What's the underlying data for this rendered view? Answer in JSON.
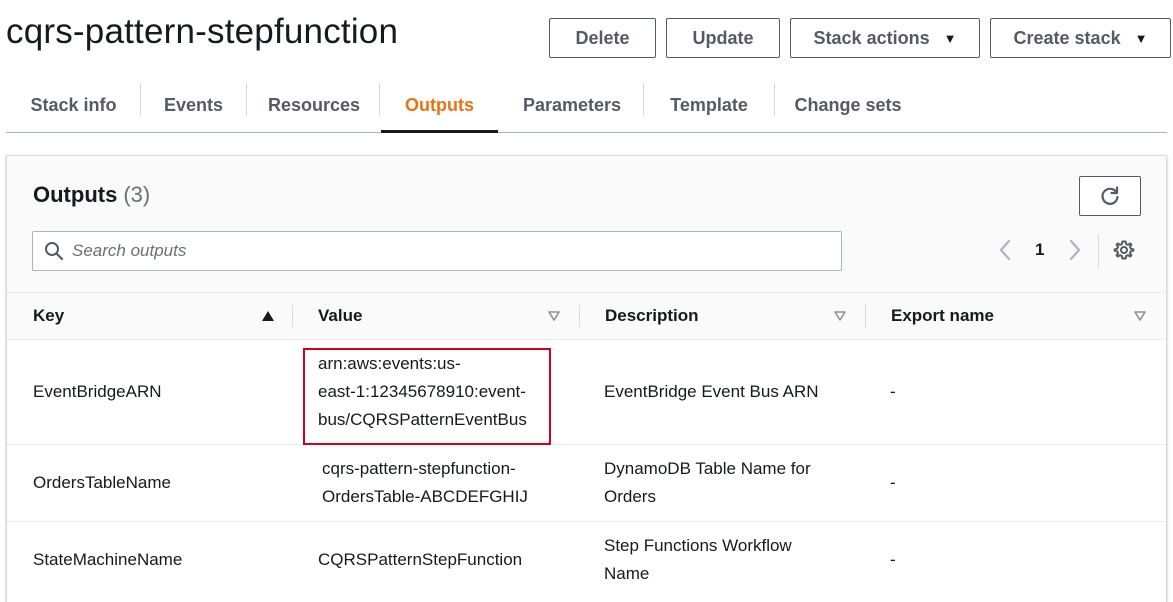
{
  "page": {
    "title": "cqrs-pattern-stepfunction"
  },
  "header_buttons": {
    "delete": "Delete",
    "update": "Update",
    "stack_actions": "Stack actions",
    "create_stack": "Create stack"
  },
  "tabs": [
    {
      "label": "Stack info"
    },
    {
      "label": "Events"
    },
    {
      "label": "Resources"
    },
    {
      "label": "Outputs",
      "active": true
    },
    {
      "label": "Parameters"
    },
    {
      "label": "Template"
    },
    {
      "label": "Change sets"
    }
  ],
  "outputs": {
    "title": "Outputs",
    "count": "(3)",
    "search_placeholder": "Search outputs",
    "page_number": "1",
    "columns": {
      "key": "Key",
      "value": "Value",
      "description": "Description",
      "export_name": "Export name"
    },
    "rows": [
      {
        "key": "EventBridgeARN",
        "value_lines": [
          "arn:aws:events:us-",
          "east-1:12345678910:event-",
          "bus/CQRSPatternEventBus"
        ],
        "description_lines": [
          "EventBridge Event Bus ARN"
        ],
        "export_name": "-"
      },
      {
        "key": "OrdersTableName",
        "value_lines": [
          "cqrs-pattern-stepfunction-",
          "OrdersTable-ABCDEFGHIJ"
        ],
        "description_lines": [
          "DynamoDB Table Name for",
          "Orders"
        ],
        "export_name": "-"
      },
      {
        "key": "StateMachineName",
        "value_lines": [
          "CQRSPatternStepFunction"
        ],
        "description_lines": [
          "Step Functions Workflow",
          "Name"
        ],
        "export_name": "-"
      }
    ]
  },
  "colors": {
    "active_tab": "#ec7211",
    "highlight_border": "#d0021b",
    "button_border": "#545b64"
  }
}
